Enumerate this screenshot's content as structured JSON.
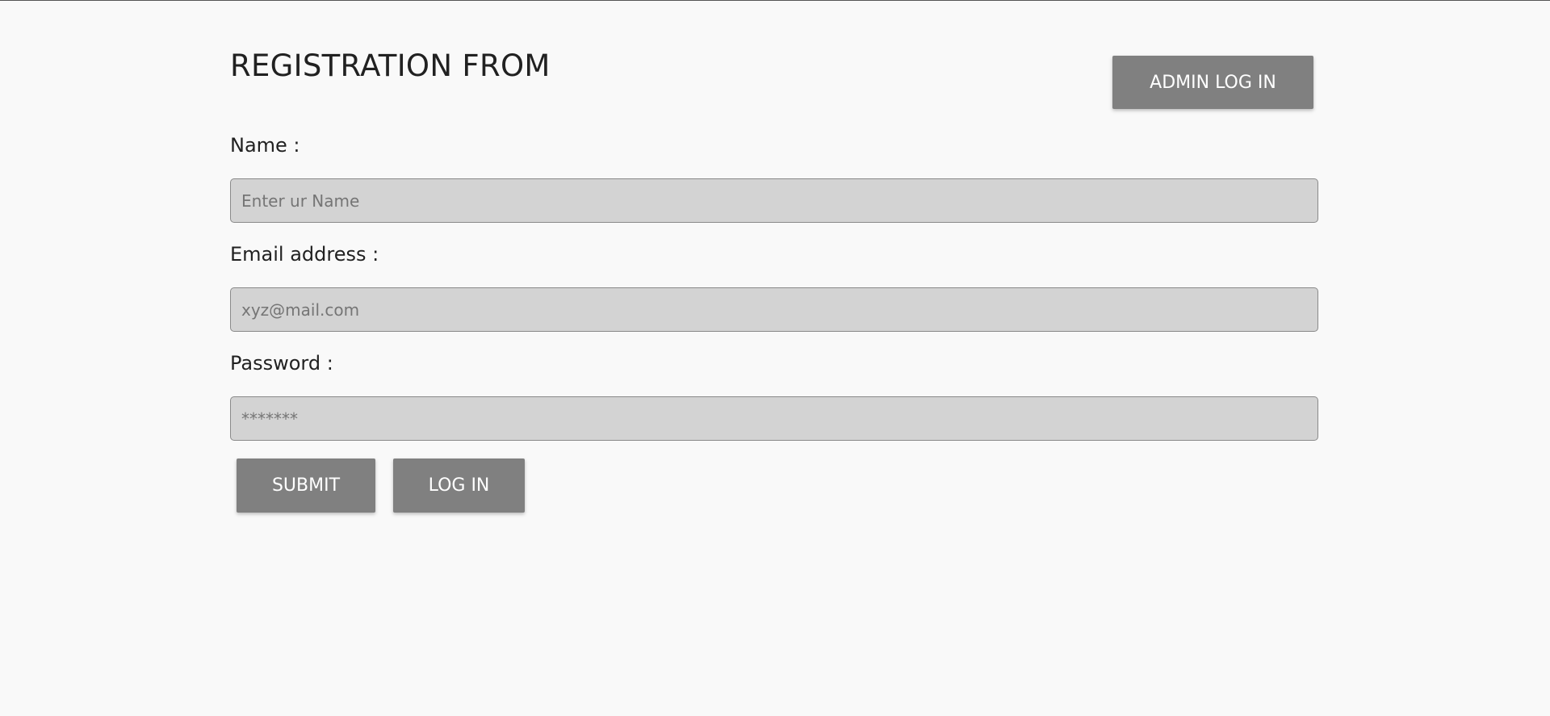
{
  "form": {
    "title": "REGISTRATION FROM",
    "admin_button_label": "ADMIN LOG IN",
    "name_label": "Name :",
    "name_placeholder": "Enter ur Name",
    "email_label": "Email address :",
    "email_placeholder": "xyz@mail.com",
    "password_label": "Password :",
    "password_placeholder": "*******",
    "submit_label": "SUBMIT",
    "login_label": "LOG IN"
  },
  "colors": {
    "background": "#f9f9f9",
    "button": "#808080",
    "input_background": "#d3d3d3",
    "text": "#212121"
  }
}
